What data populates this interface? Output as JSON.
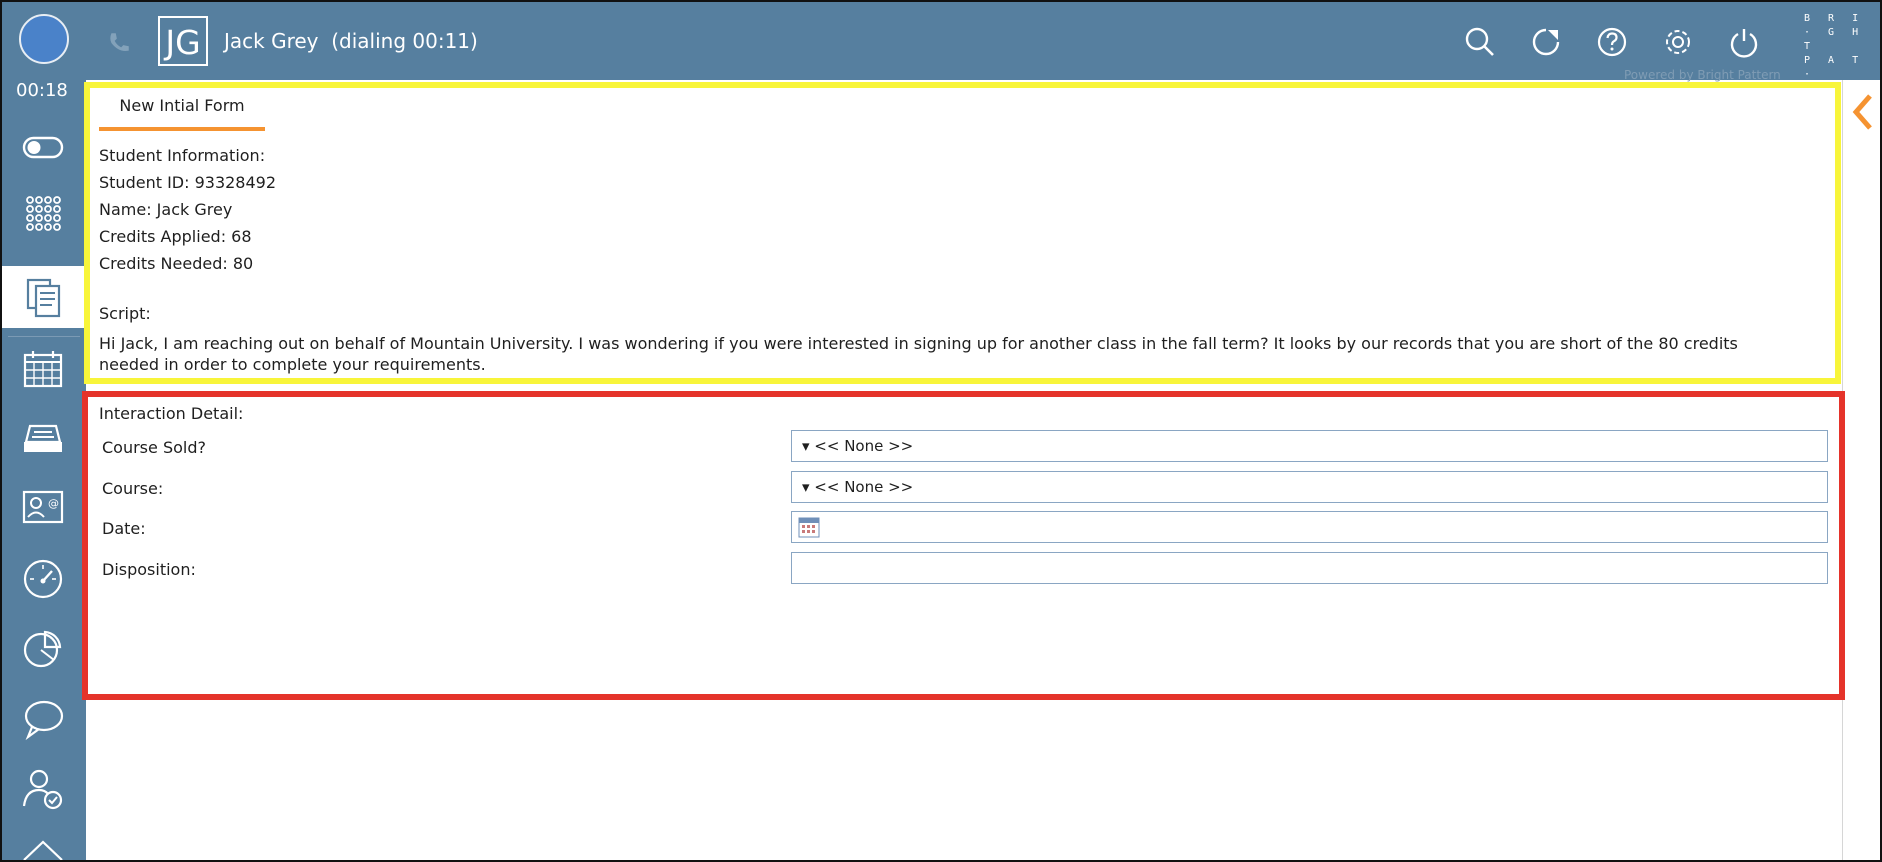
{
  "header": {
    "initials": "JG",
    "caller_name": "Jack Grey",
    "call_status": "(dialing 00:11)",
    "brand_lines": [
      "B R I",
      "· G H T",
      "P A T ·",
      "T E R N"
    ],
    "powered_by": "Powered by Bright Pattern",
    "icons": [
      "search-icon",
      "refresh-icon",
      "help-icon",
      "settings-icon",
      "power-icon"
    ]
  },
  "sidebar": {
    "timer": "00:18",
    "icons": [
      "toggle-icon",
      "dialpad-icon",
      "forms-icon",
      "calendar-icon",
      "inbox-icon",
      "contact-card-icon",
      "dashboard-gauge-icon",
      "pie-chart-icon",
      "chat-icon",
      "agent-status-icon",
      "home-icon"
    ]
  },
  "form": {
    "tab_label": "New Intial Form",
    "student_info_heading": "Student Information:",
    "student_id": "Student ID: 93328492",
    "name": "Name: Jack Grey",
    "credits_applied": "Credits Applied: 68",
    "credits_needed": "Credits Needed: 80",
    "script_heading": "Script:",
    "script_text": "Hi Jack, I am reaching out on behalf of Mountain University. I was wondering if you were interested in signing up for another class in the fall term? It looks by our records that you are short of the 80 credits needed in order to complete your requirements."
  },
  "interaction": {
    "heading": "Interaction Detail:",
    "course_sold_label": "Course Sold?",
    "course_sold_value": "▾ << None >>",
    "course_label": "Course:",
    "course_value": "▾ << None >>",
    "date_label": "Date:",
    "date_value": "",
    "disposition_label": "Disposition:",
    "disposition_value": ""
  },
  "colors": {
    "header_bg": "#567f9f",
    "tab_accent": "#f59331",
    "highlight_yellow": "#f8f53a",
    "highlight_red": "#e5332a"
  }
}
